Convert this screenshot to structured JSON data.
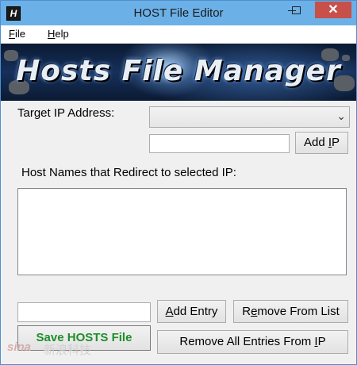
{
  "window": {
    "title": "HOST File Editor",
    "icon_letter": "H",
    "minimize_glyph": "",
    "maximize_glyph": "",
    "close_glyph": "✕"
  },
  "menu": {
    "file_accel": "F",
    "file_rest": "ile",
    "help_accel": "H",
    "help_rest": "elp"
  },
  "banner": {
    "title": "Hosts File Manager"
  },
  "target_ip": {
    "label": "Target IP Address:",
    "selected_value": "",
    "new_ip_value": "",
    "add_button_pre": "Add ",
    "add_button_accel": "I",
    "add_button_post": "P"
  },
  "hostnames": {
    "label": "Host Names that Redirect to selected IP:",
    "items": []
  },
  "entry": {
    "value": "",
    "add_pre": "",
    "add_accel": "A",
    "add_post": "dd Entry",
    "remove_pre": "R",
    "remove_accel": "e",
    "remove_post": "move From List"
  },
  "actions": {
    "save_label": "Save HOSTS File",
    "remove_all_pre": "Remove All Entries From ",
    "remove_all_accel": "I",
    "remove_all_post": "P"
  },
  "watermark": {
    "logo": "sina",
    "text": "新浪科技"
  },
  "colors": {
    "titlebar": "#6cb0e8",
    "close_button": "#c7504a",
    "save_text": "#1d8f2a"
  }
}
